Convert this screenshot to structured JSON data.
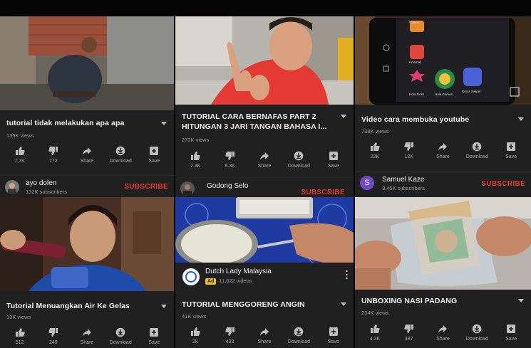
{
  "actions": {
    "share": "Share",
    "download": "Download",
    "save": "Save"
  },
  "subscribe_label": "SUBSCRIBE",
  "colors": {
    "background": "#202020",
    "subscribe": "#e53b2c",
    "ad_badge": "#f4c021",
    "avatar_samuel": "#6c4bc4"
  },
  "videos": [
    {
      "title": "tutorial tidak melakukan apa apa",
      "views": "135K views",
      "likes": "7,7K",
      "dislikes": "772",
      "channel": {
        "name": "ayo dolen",
        "subscribers": "132K subscribers",
        "avatar_icon": "person-avatar"
      }
    },
    {
      "title": "TUTORIAL CARA BERNAFAS PART 2 HITUNGAN 3 JARI TANGAN BAHASA  I...",
      "views": "272K views",
      "likes": "7.3K",
      "dislikes": "9.3K",
      "channel": {
        "name": "Godong Selo",
        "subscribers": "",
        "avatar_icon": "person-avatar"
      }
    },
    {
      "title": "Video cara membuka youtube",
      "views": "738K views",
      "likes": "22K",
      "dislikes": "12K",
      "channel": {
        "name": "Samuel Kaze",
        "subscribers": "3.45K subscribers",
        "avatar_letter": "S"
      }
    },
    {
      "title": "Tutorial Menuangkan Air Ke Gelas",
      "views": "13K views",
      "likes": "512",
      "dislikes": "249"
    },
    {
      "title": "TUTORIAL MENGGORENG ANGIN",
      "views": "41K views",
      "likes": "2K",
      "dislikes": "433"
    },
    {
      "title": "UNBOXING NASI PADANG",
      "views": "234K views",
      "likes": "4.3K",
      "dislikes": "487"
    }
  ],
  "ad_overlay": {
    "channel": "Dutch Lady Malaysia",
    "badge": "Ad",
    "videos": "11,622 videos"
  },
  "phone_screen": {
    "apps": [
      "Gallery",
      "Uninstall",
      "Hola Picks",
      "Hola Games",
      "Cross Swiper"
    ]
  }
}
